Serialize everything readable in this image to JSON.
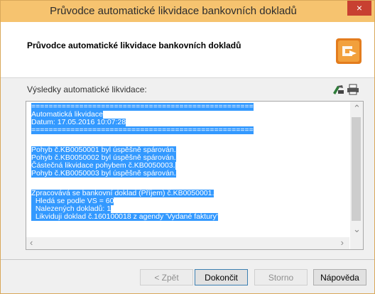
{
  "window": {
    "title": "Průvodce automatické likvidace bankovních dokladů",
    "close_glyph": "×",
    "accent": "#f6c36f",
    "close_color": "#c84031"
  },
  "header": {
    "title": "Průvodce automatické likvidace bankovních dokladů",
    "logo_icon": "wizard-logo-icon"
  },
  "results": {
    "label": "Výsledky automatické likvidace:",
    "tools": [
      "print-preview-icon",
      "print-icon"
    ],
    "selection_color": "#3399ff",
    "lines": [
      "===================================================",
      "Automatická likvidace",
      "Datum: 17.05.2016 10:07:28",
      "===================================================",
      "",
      "Pohyb č.KB0050001 byl úspěšně spárován.",
      "Pohyb č.KB0050002 byl úspěšně spárován.",
      "Částečná likvidace pohybem č.KB0050003.",
      "Pohyb č.KB0050003 byl úspěšně spárován.",
      "",
      "Zpracovává se bankovní doklad (Příjem) č.KB0050001.",
      "  Hledá se podle VS = 60",
      "  Nalezených dokladů: 1",
      "  Likviduji doklad č.160100018 z agendy 'Vydané faktury'"
    ]
  },
  "buttons": {
    "back": "< Zpět",
    "finish": "Dokončit",
    "cancel": "Storno",
    "help": "Nápověda"
  }
}
